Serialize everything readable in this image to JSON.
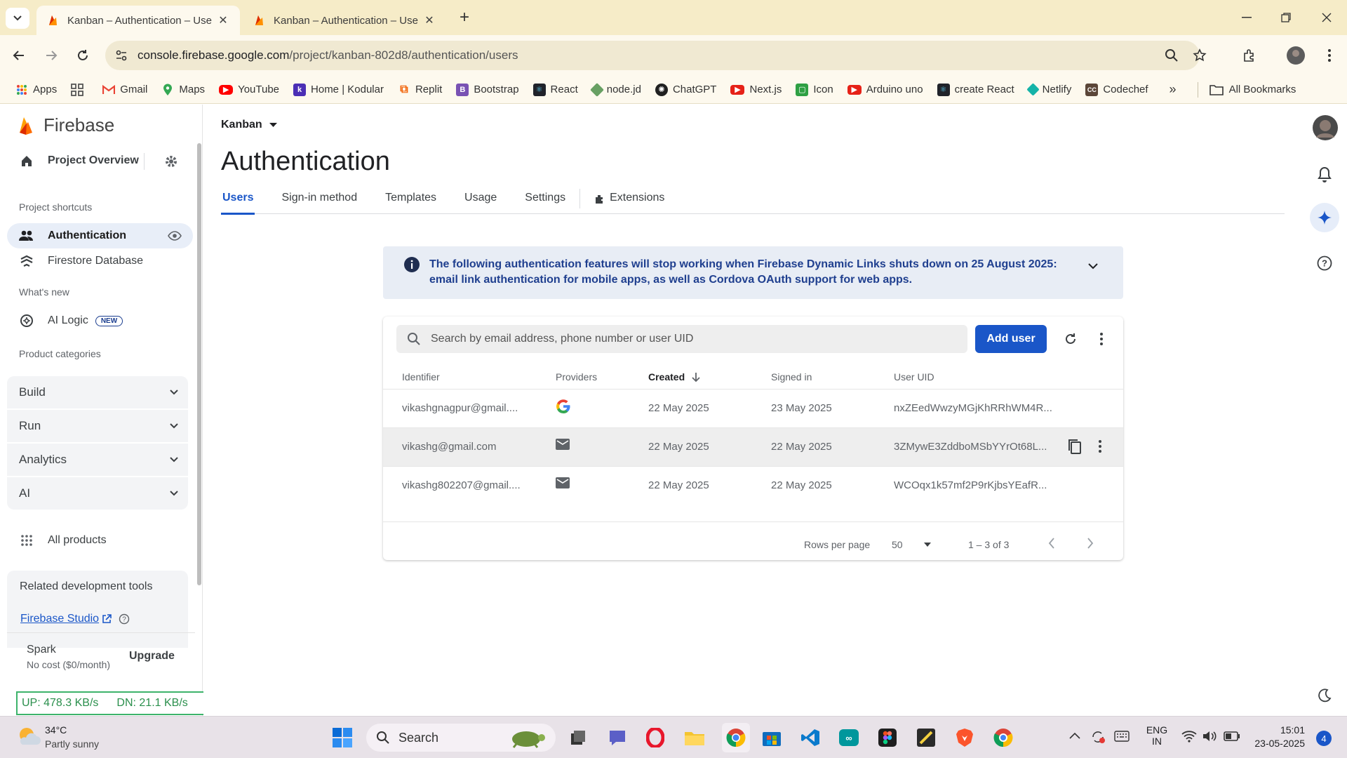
{
  "browser": {
    "tabs": [
      {
        "title": "Kanban – Authentication – User"
      },
      {
        "title": "Kanban – Authentication – User"
      }
    ],
    "url_host": "console.firebase.google.com",
    "url_path": "/project/kanban-802d8/authentication/users",
    "bookmarks": [
      {
        "label": "Apps",
        "icon": "apps-grid-icon",
        "color": "#e94235"
      },
      {
        "label": "",
        "icon": "grid-icon",
        "color": "#555555"
      },
      {
        "label": "Gmail",
        "icon": "gmail-icon",
        "color": "#ea4335"
      },
      {
        "label": "Maps",
        "icon": "maps-icon",
        "color": "#34a853"
      },
      {
        "label": "YouTube",
        "icon": "youtube-icon",
        "color": "#ff0000"
      },
      {
        "label": "Home | Kodular",
        "icon": "kodular-icon",
        "color": "#4b2fb5"
      },
      {
        "label": "Replit",
        "icon": "replit-icon",
        "color": "#f26207"
      },
      {
        "label": "Bootstrap",
        "icon": "bootstrap-icon",
        "color": "#7952b3"
      },
      {
        "label": "React",
        "icon": "react-icon",
        "color": "#20232a"
      },
      {
        "label": "node.jd",
        "icon": "nodejs-icon",
        "color": "#68a063"
      },
      {
        "label": "ChatGPT",
        "icon": "chatgpt-icon",
        "color": "#202020"
      },
      {
        "label": "Next.js",
        "icon": "nextjs-icon",
        "color": "#e62117"
      },
      {
        "label": "Icon",
        "icon": "icon-site-icon",
        "color": "#2ea043"
      },
      {
        "label": "Arduino uno",
        "icon": "arduino-icon",
        "color": "#e62117"
      },
      {
        "label": "create React",
        "icon": "create-react-icon",
        "color": "#20232a"
      },
      {
        "label": "Netlify",
        "icon": "netlify-icon",
        "color": "#15b3a8"
      },
      {
        "label": "Codechef",
        "icon": "codechef-icon",
        "color": "#5b4638"
      }
    ],
    "more_bookmarks": "»",
    "all_bookmarks": "All Bookmarks"
  },
  "sidebar": {
    "brand": "Firebase",
    "project_overview": "Project Overview",
    "project_shortcuts": "Project shortcuts",
    "authentication": "Authentication",
    "firestore": "Firestore Database",
    "whats_new": "What's new",
    "ai_logic": "AI Logic",
    "new_badge": "NEW",
    "product_categories": "Product categories",
    "categories": [
      "Build",
      "Run",
      "Analytics",
      "AI"
    ],
    "all_products": "All products",
    "related_tools": "Related development tools",
    "firebase_studio": "Firebase Studio",
    "plan_name": "Spark",
    "plan_cost": "No cost ($0/month)",
    "upgrade": "Upgrade",
    "net_up": "UP: 478.3 KB/s",
    "net_down": "DN: 21.1 KB/s"
  },
  "main": {
    "project": "Kanban",
    "title": "Authentication",
    "tabs": [
      "Users",
      "Sign-in method",
      "Templates",
      "Usage",
      "Settings"
    ],
    "extensions_tab": "Extensions",
    "banner": "The following authentication features will stop working when Firebase Dynamic Links shuts down on 25 August 2025: email link authentication for mobile apps, as well as Cordova OAuth support for web apps.",
    "search_placeholder": "Search by email address, phone number or user UID",
    "add_user": "Add user",
    "columns": {
      "identifier": "Identifier",
      "providers": "Providers",
      "created": "Created",
      "signed_in": "Signed in",
      "uid": "User UID"
    },
    "users": [
      {
        "identifier": "vikashgnagpur@gmail....",
        "provider": "google-icon",
        "created": "22 May 2025",
        "signed_in": "23 May 2025",
        "uid": "nxZEedWwzyMGjKhRRhWM4R..."
      },
      {
        "identifier": "vikashg@gmail.com",
        "provider": "email-icon",
        "created": "22 May 2025",
        "signed_in": "22 May 2025",
        "uid": "3ZMywE3ZddboMSbYYrOt68L..."
      },
      {
        "identifier": "vikashg802207@gmail....",
        "provider": "email-icon",
        "created": "22 May 2025",
        "signed_in": "22 May 2025",
        "uid": "WCOqx1k57mf2P9rKjbsYEafR..."
      }
    ],
    "rows_per_page_label": "Rows per page",
    "rows_per_page": "50",
    "range": "1 – 3 of 3"
  },
  "taskbar": {
    "temp": "34°C",
    "weather": "Partly sunny",
    "search": "Search",
    "lang1": "ENG",
    "lang2": "IN",
    "time": "15:01",
    "date": "23-05-2025",
    "notifications": "4"
  },
  "colors": {
    "accent": "#1a56c8",
    "firebase_orange": "#ff9100",
    "chrome_frame": "#f6ecc8"
  }
}
